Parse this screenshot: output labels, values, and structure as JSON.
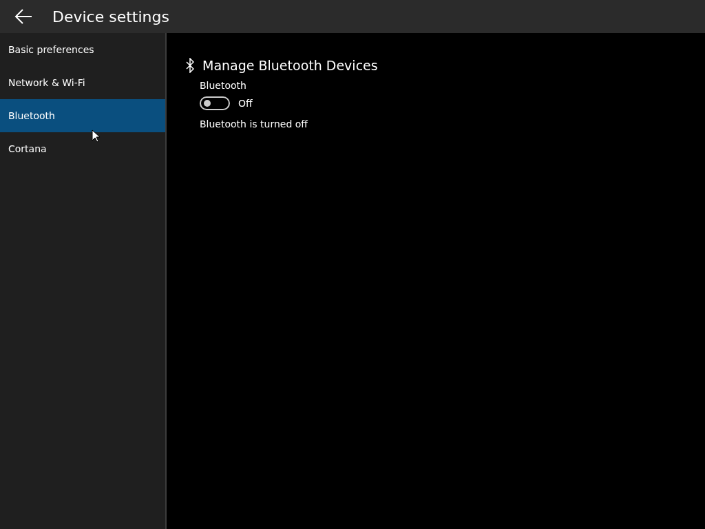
{
  "header": {
    "title": "Device settings"
  },
  "sidebar": {
    "items": [
      {
        "label": "Basic preferences",
        "selected": false
      },
      {
        "label": "Network & Wi-Fi",
        "selected": false
      },
      {
        "label": "Bluetooth",
        "selected": true
      },
      {
        "label": "Cortana",
        "selected": false
      }
    ]
  },
  "section": {
    "title": "Manage Bluetooth Devices",
    "toggle": {
      "label": "Bluetooth",
      "on": false,
      "state_text": "Off"
    },
    "status": "Bluetooth is turned off"
  }
}
